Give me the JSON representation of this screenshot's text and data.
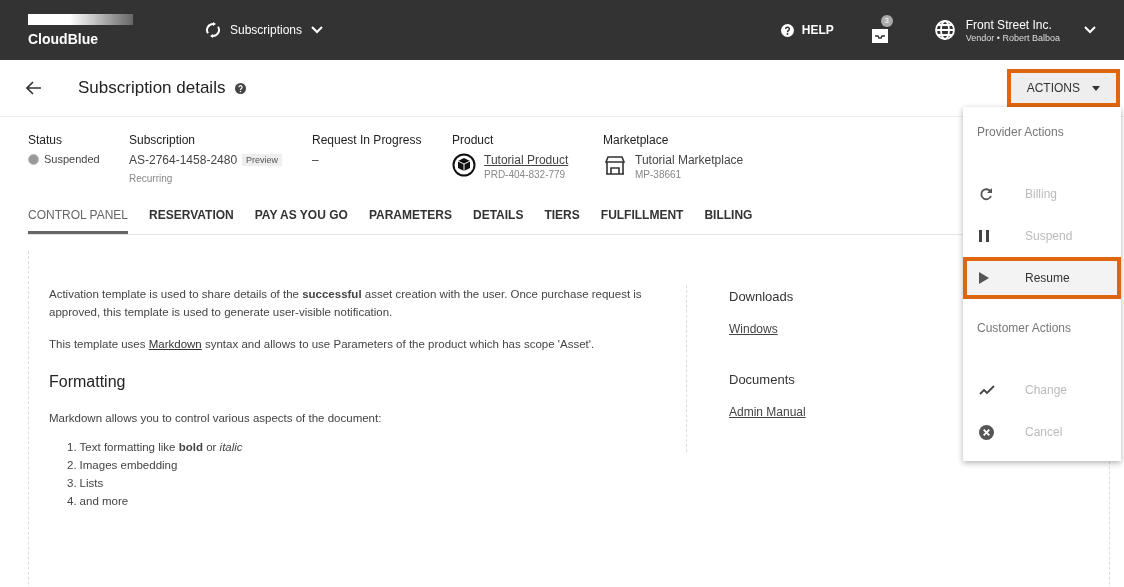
{
  "topbar": {
    "logo": "CloudBlue",
    "module": "Subscriptions",
    "help": "HELP",
    "notification_count": "3",
    "account": {
      "name": "Front Street Inc.",
      "role": "Vendor • Robert Balboa"
    }
  },
  "header": {
    "title": "Subscription details",
    "actions_button": {
      "label": "ACTIONS",
      "highlighted": true
    }
  },
  "summary": [
    {
      "kind": "status",
      "label": "Status",
      "value": "Suspended"
    },
    {
      "kind": "id",
      "label": "Subscription",
      "value": "AS-2764-1458-2480",
      "badge": "Preview",
      "sub": "Recurring"
    },
    {
      "kind": "text",
      "label": "Request In Progress",
      "value": "–"
    },
    {
      "kind": "product",
      "label": "Product",
      "value": "Tutorial Product",
      "sub": "PRD-404-832-779"
    },
    {
      "kind": "marketplace",
      "label": "Marketplace",
      "value": "Tutorial Marketplace",
      "sub": "MP-38661"
    }
  ],
  "tabs": [
    {
      "label": "CONTROL PANEL",
      "selected": true
    },
    {
      "label": "RESERVATION",
      "selected": false
    },
    {
      "label": "PAY AS YOU GO",
      "selected": false
    },
    {
      "label": "PARAMETERS",
      "selected": false
    },
    {
      "label": "DETAILS",
      "selected": false
    },
    {
      "label": "TIERS",
      "selected": false
    },
    {
      "label": "FULFILLMENT",
      "selected": false
    },
    {
      "label": "BILLING",
      "selected": false
    }
  ],
  "content": {
    "intro": "Activation template is used to share details of the **successful** asset creation with the user. Once purchase request is approved, this template is used to generate user-visible notification.",
    "markdown_note": {
      "before": "This template uses ",
      "link": "Markdown",
      "after": " syntax and allows to use Parameters of the product which has scope 'Asset'."
    },
    "heading": "Formatting",
    "lead": "Markdown allows you to control various aspects of the document:",
    "list": [
      {
        "number": "1.",
        "text": "Text formatting like **bold** or *italic*"
      },
      {
        "number": "2.",
        "text": "Images embedding"
      },
      {
        "number": "3.",
        "text": "Lists"
      },
      {
        "number": "4.",
        "text": "and more"
      }
    ]
  },
  "side": [
    {
      "title": "Downloads",
      "links": [
        "Windows"
      ]
    },
    {
      "title": "Documents",
      "links": [
        "Admin Manual"
      ]
    }
  ],
  "actions_menu": {
    "sections": [
      {
        "title": "Provider Actions",
        "items": [
          {
            "kind": "refresh",
            "label": "Billing",
            "disabled": true,
            "highlighted": false
          },
          {
            "kind": "pause",
            "label": "Suspend",
            "disabled": true,
            "highlighted": false
          },
          {
            "kind": "play",
            "label": "Resume",
            "disabled": false,
            "highlighted": true
          }
        ]
      },
      {
        "title": "Customer Actions",
        "items": [
          {
            "kind": "trend",
            "label": "Change",
            "disabled": true,
            "highlighted": false
          },
          {
            "kind": "cancel",
            "label": "Cancel",
            "disabled": true,
            "highlighted": false
          }
        ]
      }
    ]
  }
}
